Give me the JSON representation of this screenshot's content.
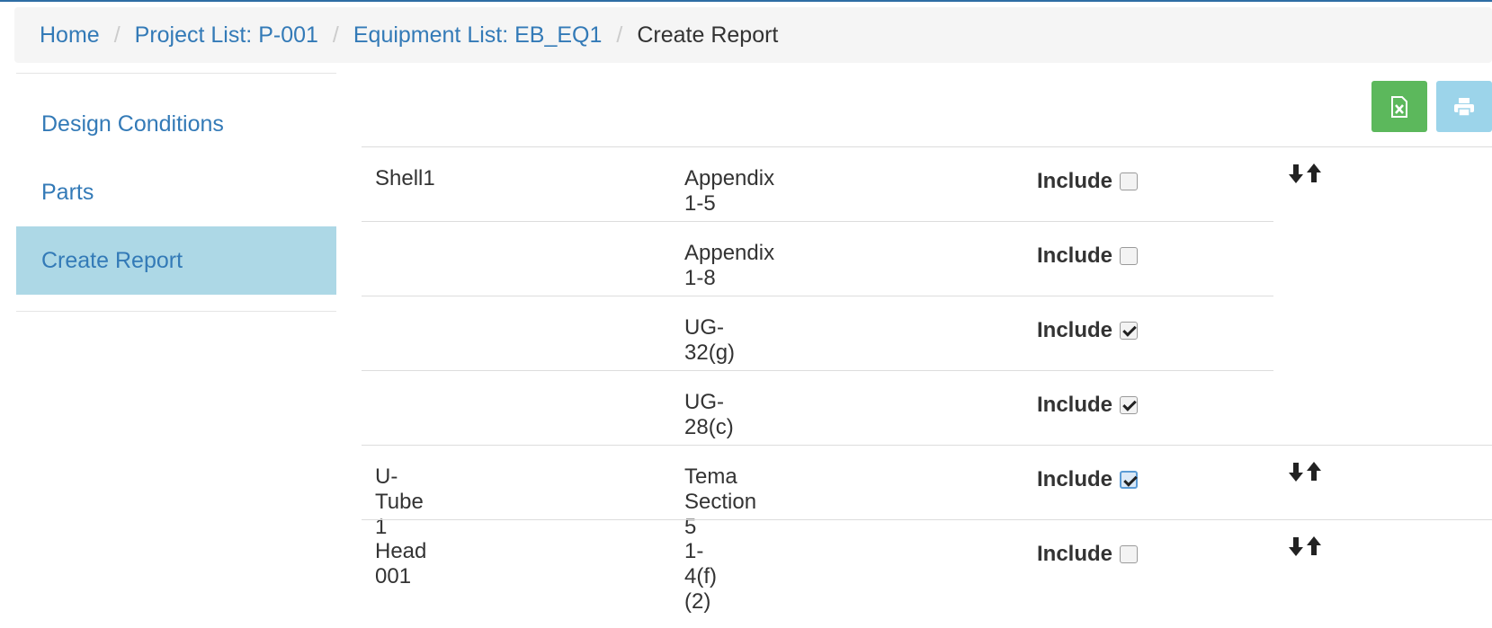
{
  "breadcrumb": {
    "items": [
      "Home",
      "Project List: P-001",
      "Equipment List: EB_EQ1"
    ],
    "current": "Create Report",
    "separator": "/"
  },
  "sidebar": {
    "items": [
      {
        "label": "Design Conditions",
        "active": false
      },
      {
        "label": "Parts",
        "active": false
      },
      {
        "label": "Create Report",
        "active": true
      }
    ]
  },
  "toolbar": {
    "excel_icon": "file-excel-icon",
    "print_icon": "print-icon"
  },
  "report": {
    "rows": [
      {
        "part": "Shell1",
        "section": "Appendix 1-5",
        "include_label": "Include",
        "checked": false,
        "arrows": true
      },
      {
        "part": "",
        "section": "Appendix 1-8",
        "include_label": "Include",
        "checked": false,
        "arrows": false
      },
      {
        "part": "",
        "section": "UG-32(g)",
        "include_label": "Include",
        "checked": true,
        "arrows": false
      },
      {
        "part": "",
        "section": "UG-28(c)",
        "include_label": "Include",
        "checked": true,
        "arrows": false
      },
      {
        "part": "U-Tube 1",
        "section": "Tema Section 5",
        "include_label": "Include",
        "checked": true,
        "arrows": true
      },
      {
        "part": "Head 001",
        "section": "1-4(f)(2)",
        "include_label": "Include",
        "checked": false,
        "arrows": true
      }
    ]
  },
  "colors": {
    "link": "#337ab7",
    "active_bg": "#add8e6",
    "excel_btn": "#5cb85c",
    "print_btn": "#9cd4ea"
  }
}
